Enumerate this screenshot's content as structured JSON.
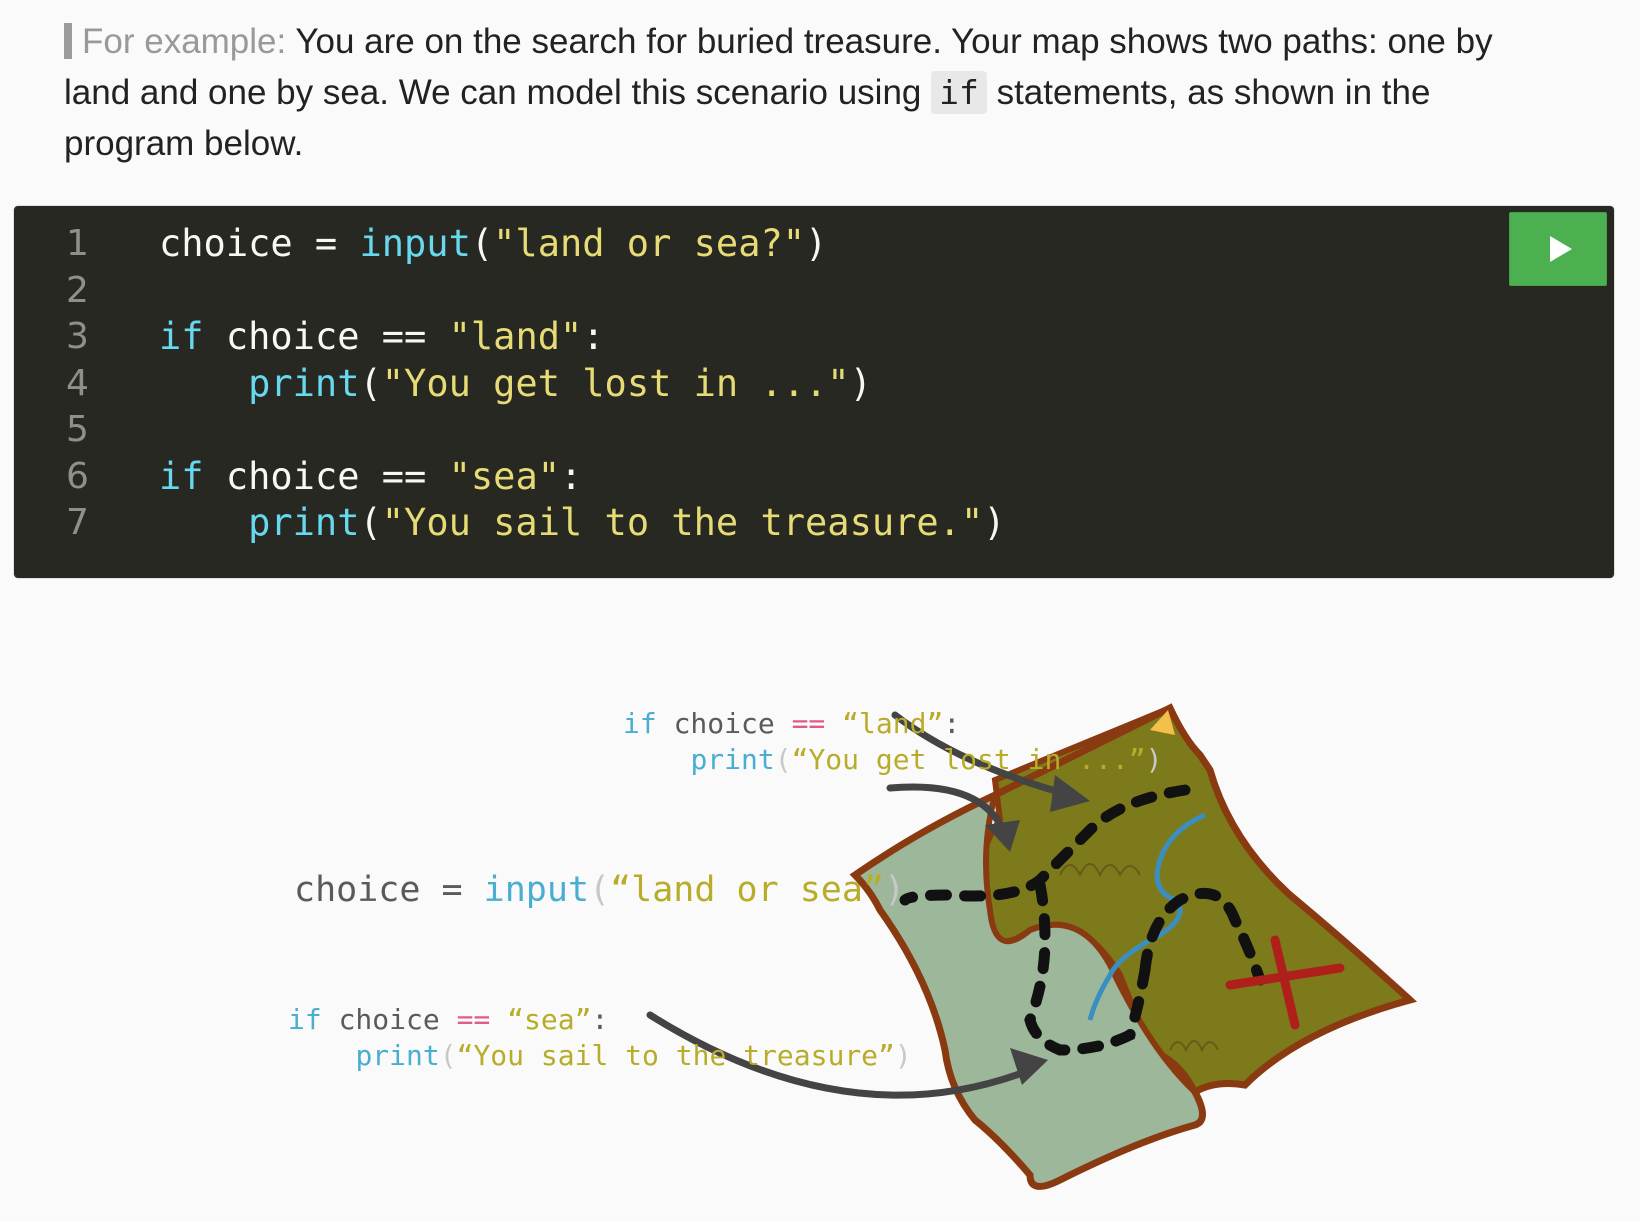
{
  "intro": {
    "lead": "For example:",
    "text_before": " You are on the search for buried treasure. Your map shows two paths: one by land and one by sea. We can model this scenario using ",
    "inline_code": "if",
    "text_after": " statements, as shown in the program below."
  },
  "editor": {
    "run_icon": "play-icon",
    "lines": [
      {
        "num": "1",
        "tokens": [
          {
            "t": "choice",
            "c": "v"
          },
          {
            "t": " = ",
            "c": "o"
          },
          {
            "t": "input",
            "c": "k"
          },
          {
            "t": "(",
            "c": "o"
          },
          {
            "t": "\"land or sea?\"",
            "c": "s"
          },
          {
            "t": ")",
            "c": "o"
          }
        ]
      },
      {
        "num": "2",
        "tokens": []
      },
      {
        "num": "3",
        "tokens": [
          {
            "t": "if",
            "c": "k"
          },
          {
            "t": " choice ",
            "c": "v"
          },
          {
            "t": "==",
            "c": "o"
          },
          {
            "t": " ",
            "c": "o"
          },
          {
            "t": "\"land\"",
            "c": "s"
          },
          {
            "t": ":",
            "c": "o"
          }
        ]
      },
      {
        "num": "4",
        "tokens": [
          {
            "t": "    ",
            "c": "o"
          },
          {
            "t": "print",
            "c": "k"
          },
          {
            "t": "(",
            "c": "o"
          },
          {
            "t": "\"You get lost in ...\"",
            "c": "s"
          },
          {
            "t": ")",
            "c": "o"
          }
        ]
      },
      {
        "num": "5",
        "tokens": []
      },
      {
        "num": "6",
        "tokens": [
          {
            "t": "if",
            "c": "k"
          },
          {
            "t": " choice ",
            "c": "v"
          },
          {
            "t": "==",
            "c": "o"
          },
          {
            "t": " ",
            "c": "o"
          },
          {
            "t": "\"sea\"",
            "c": "s"
          },
          {
            "t": ":",
            "c": "o"
          }
        ]
      },
      {
        "num": "7",
        "tokens": [
          {
            "t": "    ",
            "c": "o"
          },
          {
            "t": "print",
            "c": "k"
          },
          {
            "t": "(",
            "c": "o"
          },
          {
            "t": "\"You sail to the treasure.\"",
            "c": "s"
          },
          {
            "t": ")",
            "c": "o"
          }
        ]
      }
    ]
  },
  "illustration": {
    "land_annotation": {
      "line1": [
        {
          "t": "if",
          "c": "k"
        },
        {
          "t": " choice ",
          "c": "v"
        },
        {
          "t": "==",
          "c": "op"
        },
        {
          "t": " ",
          "c": "v"
        },
        {
          "t": "“land”",
          "c": "s"
        },
        {
          "t": ":",
          "c": "v"
        }
      ],
      "line2": [
        {
          "t": "    ",
          "c": "v"
        },
        {
          "t": "print",
          "c": "k"
        },
        {
          "t": "(",
          "c": "p"
        },
        {
          "t": "“You get lost in ...”",
          "c": "s"
        },
        {
          "t": ")",
          "c": "p"
        }
      ]
    },
    "input_annotation": {
      "line1": [
        {
          "t": "choice",
          "c": "v"
        },
        {
          "t": " = ",
          "c": "v"
        },
        {
          "t": "input",
          "c": "k"
        },
        {
          "t": "(",
          "c": "p"
        },
        {
          "t": "“land or sea”",
          "c": "s"
        },
        {
          "t": ")",
          "c": "p"
        }
      ]
    },
    "sea_annotation": {
      "line1": [
        {
          "t": "if",
          "c": "k"
        },
        {
          "t": " choice ",
          "c": "v"
        },
        {
          "t": "==",
          "c": "op"
        },
        {
          "t": " ",
          "c": "v"
        },
        {
          "t": "“sea”",
          "c": "s"
        },
        {
          "t": ":",
          "c": "v"
        }
      ],
      "line2": [
        {
          "t": "    ",
          "c": "v"
        },
        {
          "t": "print",
          "c": "k"
        },
        {
          "t": "(",
          "c": "p"
        },
        {
          "t": "“You sail to the treasure”",
          "c": "s"
        },
        {
          "t": ")",
          "c": "p"
        }
      ]
    },
    "colors": {
      "land": "#7d7a1c",
      "sea": "#9db79a",
      "border": "#8a3a10",
      "river": "#3b8fc0",
      "x_mark": "#b0201a",
      "arrow": "#444444"
    }
  }
}
